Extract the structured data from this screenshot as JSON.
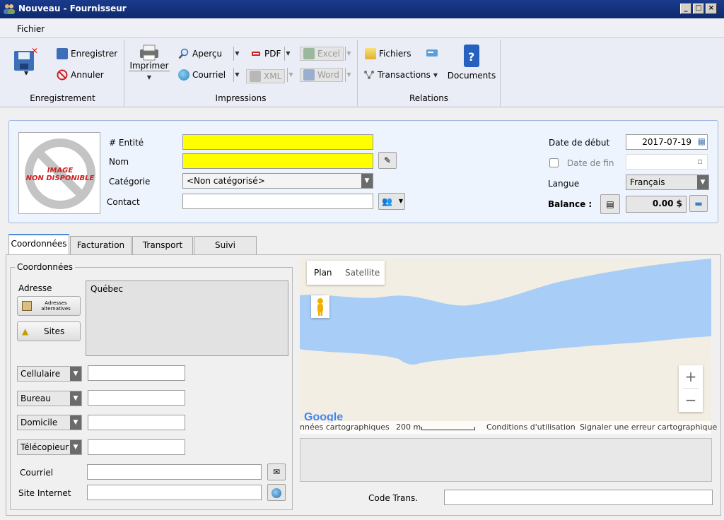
{
  "window": {
    "title": "Nouveau - Fournisseur",
    "controls": [
      "_",
      "□",
      "×"
    ]
  },
  "menu": {
    "file": "Fichier"
  },
  "ribbon": {
    "enregistrement": {
      "label": "Enregistrement",
      "save": "Enregistrer",
      "cancel": "Annuler"
    },
    "impressions": {
      "label": "Impressions",
      "print": "Imprimer",
      "preview": "Aperçu",
      "email": "Courriel",
      "pdf": "PDF",
      "xml": "XML",
      "excel": "Excel",
      "word": "Word"
    },
    "relations": {
      "label": "Relations",
      "files": "Fichiers",
      "transactions": "Transactions",
      "documents": "Documents"
    }
  },
  "header": {
    "image_placeholder_line1": "IMAGE",
    "image_placeholder_line2": "NON DISPONIBLE",
    "entity_label": "# Entité",
    "entity_value": "",
    "name_label": "Nom",
    "name_value": "",
    "category_label": "Catégorie",
    "category_value": "<Non catégorisé>",
    "contact_label": "Contact",
    "contact_value": "",
    "start_date_label": "Date de début",
    "start_date_value": "2017-07-19",
    "end_date_label": "Date de fin",
    "end_date_value": "",
    "language_label": "Langue",
    "language_value": "Français",
    "balance_label": "Balance :",
    "balance_value": "0.00 $"
  },
  "tabs": [
    {
      "label": "Coordonnées",
      "active": true
    },
    {
      "label": "Facturation",
      "active": false
    },
    {
      "label": "Transport",
      "active": false
    },
    {
      "label": "Suivi",
      "active": false
    }
  ],
  "coordonnees": {
    "legend": "Coordonnées",
    "address_label": "Adresse",
    "address_value": "Québec",
    "alt_addresses_btn_line1": "Adresses",
    "alt_addresses_btn_line2": "alternatives",
    "sites_btn": "Sites",
    "phones": [
      {
        "type": "Cellulaire",
        "value": ""
      },
      {
        "type": "Bureau",
        "value": ""
      },
      {
        "type": "Domicile",
        "value": ""
      },
      {
        "type": "Télécopieur",
        "value": ""
      }
    ],
    "email_label": "Courriel",
    "email_value": "",
    "website_label": "Site Internet",
    "website_value": ""
  },
  "map": {
    "type_plan": "Plan",
    "type_satellite": "Satellite",
    "logo": "Google",
    "attribution": "nnées cartographiques",
    "scale": "200 m",
    "terms": "Conditions d'utilisation",
    "report": "Signaler une erreur cartographique",
    "zoom_in": "+",
    "zoom_out": "−",
    "colors": {
      "water": "#a8cdf7",
      "land": "#f3eee3"
    }
  },
  "code_trans": {
    "label": "Code Trans.",
    "value": ""
  }
}
